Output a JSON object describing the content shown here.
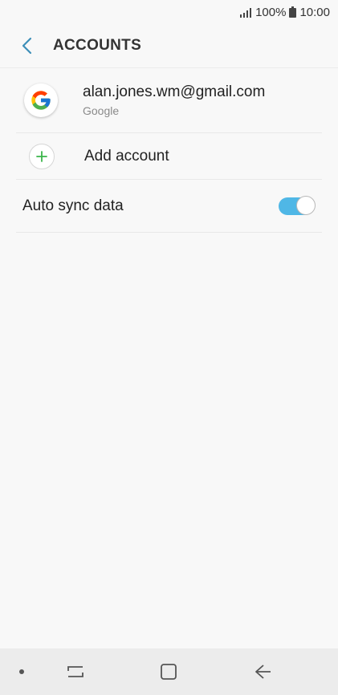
{
  "status_bar": {
    "battery_percent": "100%",
    "time": "10:00",
    "icons": [
      "signal-icon",
      "battery-icon"
    ]
  },
  "header": {
    "title": "ACCOUNTS",
    "back_icon": "back-arrow-icon"
  },
  "accounts": [
    {
      "email": "alan.jones.wm@gmail.com",
      "type": "Google",
      "icon": "google-logo-icon"
    }
  ],
  "add_account": {
    "label": "Add account",
    "icon": "plus-icon"
  },
  "auto_sync": {
    "label": "Auto sync data",
    "enabled": true
  },
  "nav_bar": {
    "icons": [
      "home-dot-icon",
      "recents-icon",
      "home-icon",
      "back-icon"
    ]
  },
  "colors": {
    "accent": "#4fb7e6",
    "back_arrow": "#3d8fb8",
    "plus": "#3ab549",
    "background": "#f8f8f8"
  }
}
